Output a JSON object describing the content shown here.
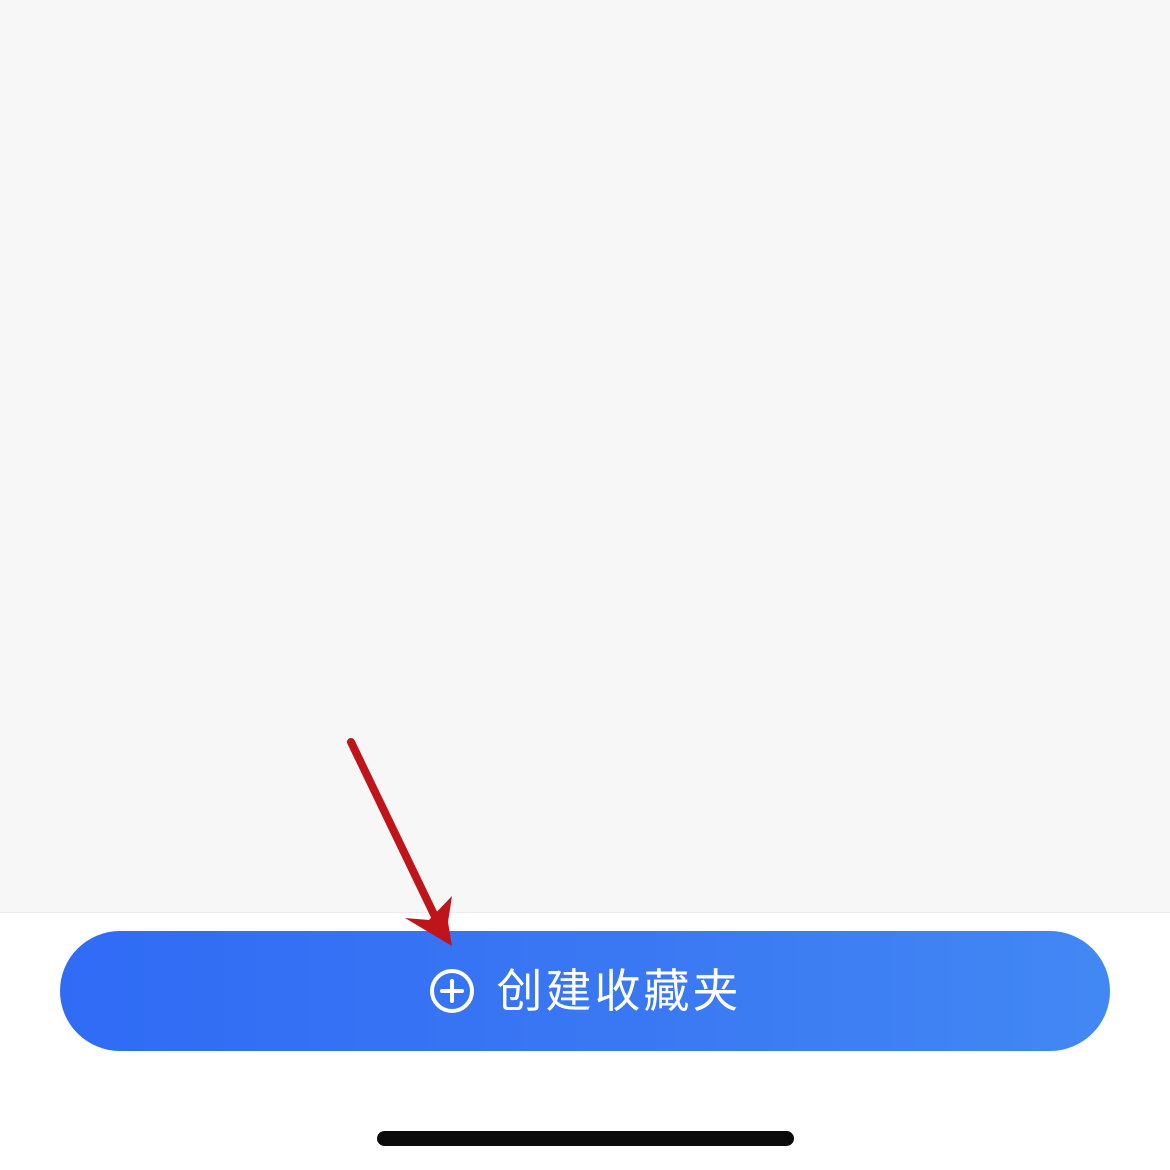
{
  "create_folder_button": {
    "label": "创建收藏夹",
    "icon": "plus-circle-icon"
  },
  "colors": {
    "content_background": "#f7f7f8",
    "button_gradient_start": "#2f6bf5",
    "button_gradient_end": "#4288f4",
    "button_text": "#ffffff",
    "annotation_arrow": "#c0141b",
    "home_indicator": "#0b0b0b"
  },
  "annotation": {
    "icon": "red-arrow-icon"
  }
}
